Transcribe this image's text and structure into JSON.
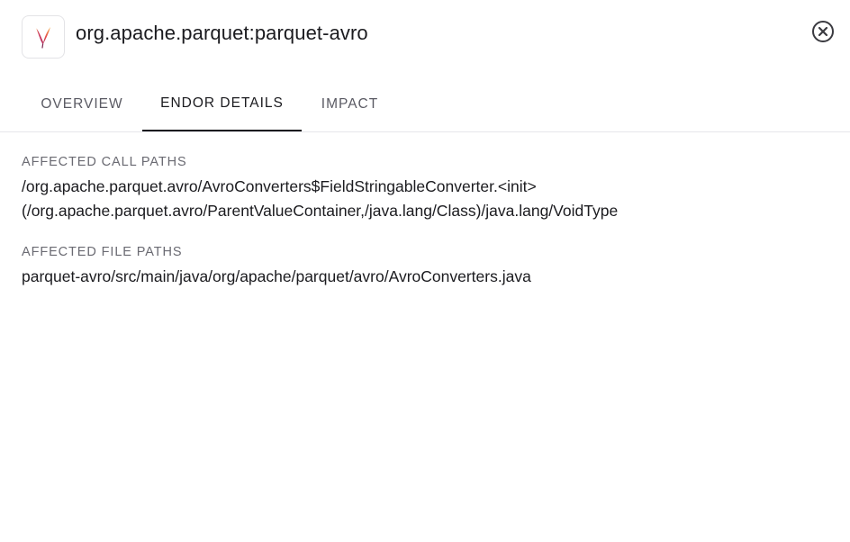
{
  "header": {
    "title": "org.apache.parquet:parquet-avro",
    "logo_icon": "apache-feather-icon",
    "close_icon": "close-circle-icon"
  },
  "tabs": [
    {
      "label": "OVERVIEW",
      "active": false
    },
    {
      "label": "ENDOR DETAILS",
      "active": true
    },
    {
      "label": "IMPACT",
      "active": false
    }
  ],
  "details": {
    "call_paths_label": "AFFECTED CALL PATHS",
    "call_paths_line1": "/org.apache.parquet.avro/AvroConverters$FieldStringableConverter.<init>",
    "call_paths_line2": "(/org.apache.parquet.avro/ParentValueContainer,/java.lang/Class)/java.lang/VoidType",
    "file_paths_label": "AFFECTED FILE PATHS",
    "file_paths_value": "parquet-avro/src/main/java/org/apache/parquet/avro/AvroConverters.java"
  },
  "colors": {
    "text_primary": "#1b1b1f",
    "text_muted": "#6a6a72",
    "border": "#e6e6ea"
  }
}
